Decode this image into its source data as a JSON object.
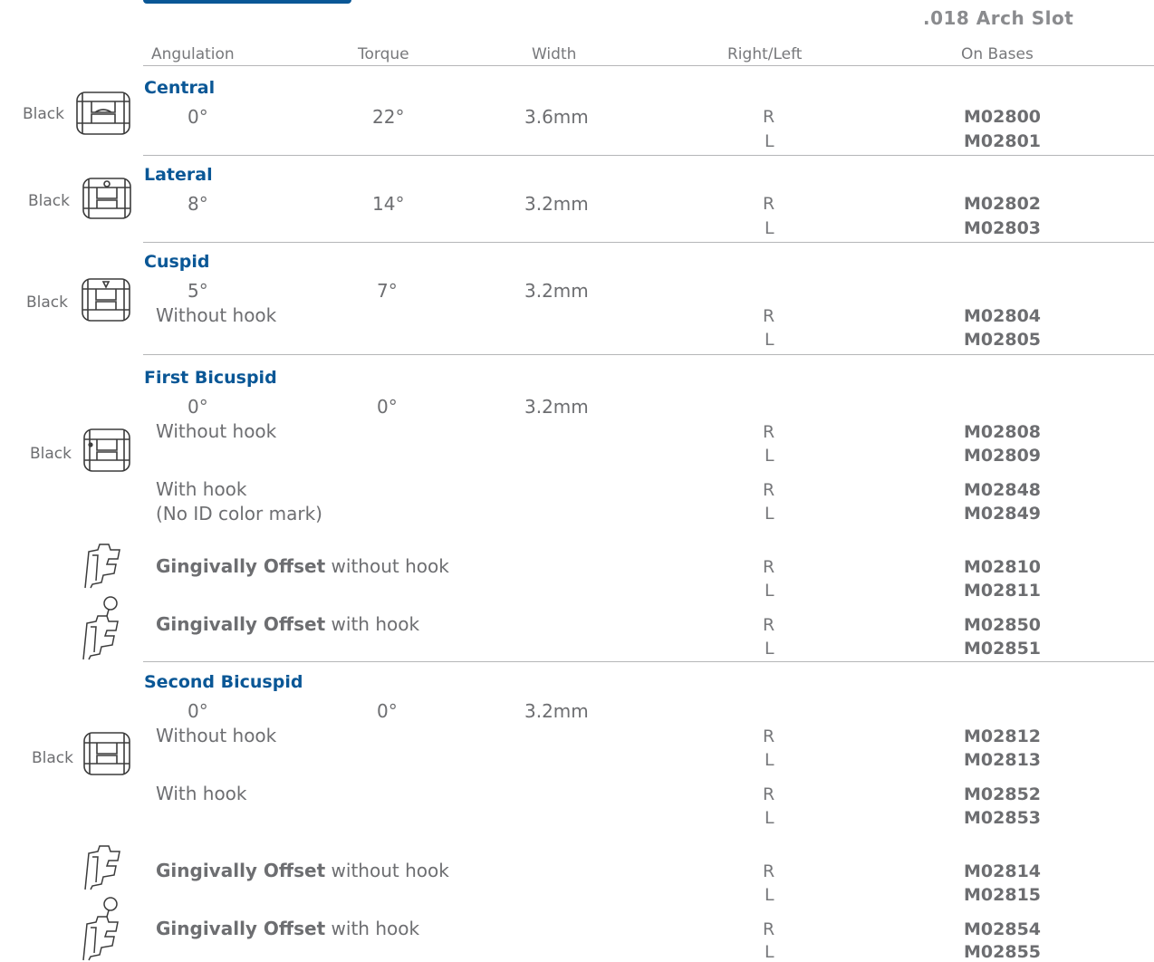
{
  "slot_label": ".018 Arch Slot",
  "columns": {
    "angulation": "Angulation",
    "torque": "Torque",
    "width": "Width",
    "right_left": "Right/Left",
    "on_bases": "On Bases"
  },
  "sections": {
    "central": {
      "name": "Central",
      "color_label": "Black",
      "angulation": "0°",
      "torque": "22°",
      "width": "3.6mm",
      "r": "R",
      "l": "L",
      "code_r": "M02800",
      "code_l": "M02801"
    },
    "lateral": {
      "name": "Lateral",
      "color_label": "Black",
      "angulation": "8°",
      "torque": "14°",
      "width": "3.2mm",
      "r": "R",
      "l": "L",
      "code_r": "M02802",
      "code_l": "M02803"
    },
    "cuspid": {
      "name": "Cuspid",
      "color_label": "Black",
      "angulation": "5°",
      "torque": "7°",
      "width": "3.2mm",
      "without_hook": "Without hook",
      "r": "R",
      "l": "L",
      "code_r": "M02804",
      "code_l": "M02805"
    },
    "first_bicuspid": {
      "name": "First Bicuspid",
      "color_label": "Black",
      "angulation": "0°",
      "torque": "0°",
      "width": "3.2mm",
      "without_hook": "Without hook",
      "wo_r": "R",
      "wo_l": "L",
      "wo_code_r": "M02808",
      "wo_code_l": "M02809",
      "with_hook": "With hook",
      "with_hook_note": "(No ID color mark)",
      "wh_r": "R",
      "wh_l": "L",
      "wh_code_r": "M02848",
      "wh_code_l": "M02849",
      "go_bold": "Gingivally Offset",
      "go_without": " without hook",
      "go_wo_r": "R",
      "go_wo_l": "L",
      "go_wo_code_r": "M02810",
      "go_wo_code_l": "M02811",
      "go_with": " with hook",
      "go_wh_r": "R",
      "go_wh_l": "L",
      "go_wh_code_r": "M02850",
      "go_wh_code_l": "M02851"
    },
    "second_bicuspid": {
      "name": "Second Bicuspid",
      "color_label": "Black",
      "angulation": "0°",
      "torque": "0°",
      "width": "3.2mm",
      "without_hook": "Without hook",
      "wo_r": "R",
      "wo_l": "L",
      "wo_code_r": "M02812",
      "wo_code_l": "M02813",
      "with_hook": "With hook",
      "wh_r": "R",
      "wh_l": "L",
      "wh_code_r": "M02852",
      "wh_code_l": "M02853",
      "go_bold": "Gingivally Offset",
      "go_without": " without hook",
      "go_wo_r": "R",
      "go_wo_l": "L",
      "go_wo_code_r": "M02814",
      "go_wo_code_l": "M02815",
      "go_with": " with hook",
      "go_wh_r": "R",
      "go_wh_l": "L",
      "go_wh_code_r": "M02854",
      "go_wh_code_l": "M02855"
    }
  },
  "icons": {
    "bracket": "bracket-icon",
    "offset_bracket": "offset-bracket-icon",
    "offset_hook_bracket": "offset-hook-bracket-icon"
  }
}
